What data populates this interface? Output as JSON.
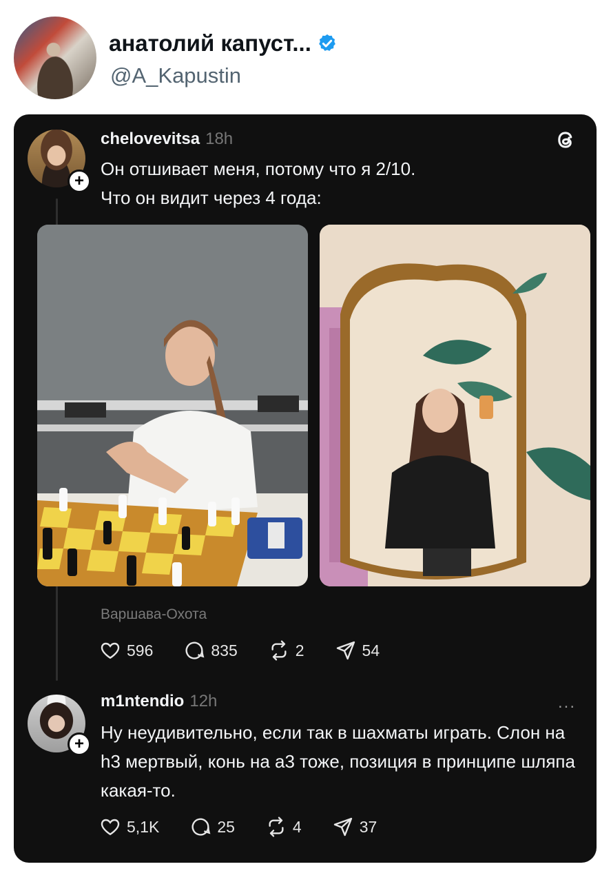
{
  "tweet": {
    "display_name": "анатолий капуст...",
    "handle": "@A_Kapustin",
    "verified_icon": "verified-badge-icon"
  },
  "threads_post": {
    "username": "chelovevitsa",
    "time": "18h",
    "text_line1": "Он отшивает меня, потому что я 2/10.",
    "text_line2": "Что он видит через 4 года:",
    "location": "Варшава-Охота",
    "stats": {
      "likes": "596",
      "replies": "835",
      "reposts": "2",
      "shares": "54"
    }
  },
  "reply": {
    "username": "m1ntendio",
    "time": "12h",
    "text": "Ну неудивительно, если так в шахматы играть. Слон на h3 мертвый, конь на а3 тоже, позиция в принципе шляпа какая-то.",
    "more_label": "...",
    "stats": {
      "likes": "5,1K",
      "replies": "25",
      "reposts": "4",
      "shares": "37"
    }
  },
  "colors": {
    "card_bg": "#101010",
    "verified": "#1d9bf0",
    "text": "#f3f5f7"
  }
}
